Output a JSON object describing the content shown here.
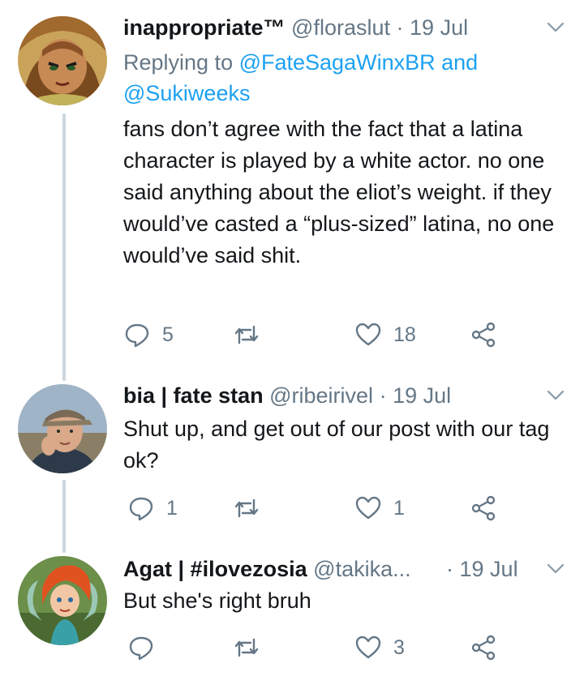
{
  "tweets": [
    {
      "name": "inappropriate™",
      "handle": "@floraslut",
      "dot": "·",
      "time": "19 Jul",
      "replying_prefix": "Replying to ",
      "replying_user1": "@FateSagaWinxBR",
      "replying_and": " and",
      "replying_user2": "@Sukiweeks",
      "text": "fans don’t agree with the fact that a latina character is played by a white actor. no one said anything about the eliot’s weight. if they would’ve casted a “plus-sized” latina, no one would’ve said shit.",
      "replies": "5",
      "retweets": "",
      "likes": "18"
    },
    {
      "name": "bia | fate stan",
      "handle": "@ribeirivel",
      "dot": "·",
      "time": "19 Jul",
      "text": "Shut up, and get out of our post with our tag ok?",
      "replies": "1",
      "retweets": "",
      "likes": "1"
    },
    {
      "name": "Agat | #ilovezosia",
      "handle": "@takika...",
      "dot": "·",
      "time": "19 Jul",
      "text": "But she's right bruh",
      "replies": "",
      "retweets": "",
      "likes": "3"
    }
  ],
  "icons": {
    "reply": "reply-icon",
    "retweet": "retweet-icon",
    "like": "heart-icon",
    "share": "share-icon",
    "more": "chevron-down-icon"
  },
  "colors": {
    "link": "#1da1f2",
    "muted": "#657786",
    "text": "#14171a",
    "thread_line": "#ccd6dd"
  }
}
